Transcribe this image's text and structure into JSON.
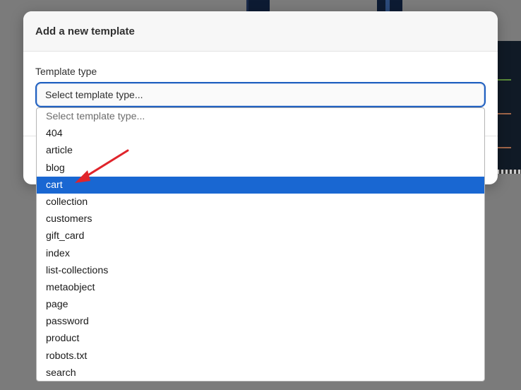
{
  "modal": {
    "title": "Add a new template",
    "field_label": "Template type"
  },
  "select": {
    "current_value": "Select template type..."
  },
  "dropdown": {
    "options": [
      "Select template type...",
      "404",
      "article",
      "blog",
      "cart",
      "collection",
      "customers",
      "gift_card",
      "index",
      "list-collections",
      "metaobject",
      "page",
      "password",
      "product",
      "robots.txt",
      "search"
    ],
    "highlighted_option": "cart"
  },
  "colors": {
    "highlight": "#1967d2",
    "focus_border": "#1f5fbf",
    "annotation_arrow": "#e0242b",
    "overlay": "#7b7b7b"
  },
  "annotation": {
    "icon": "red-arrow-icon"
  }
}
